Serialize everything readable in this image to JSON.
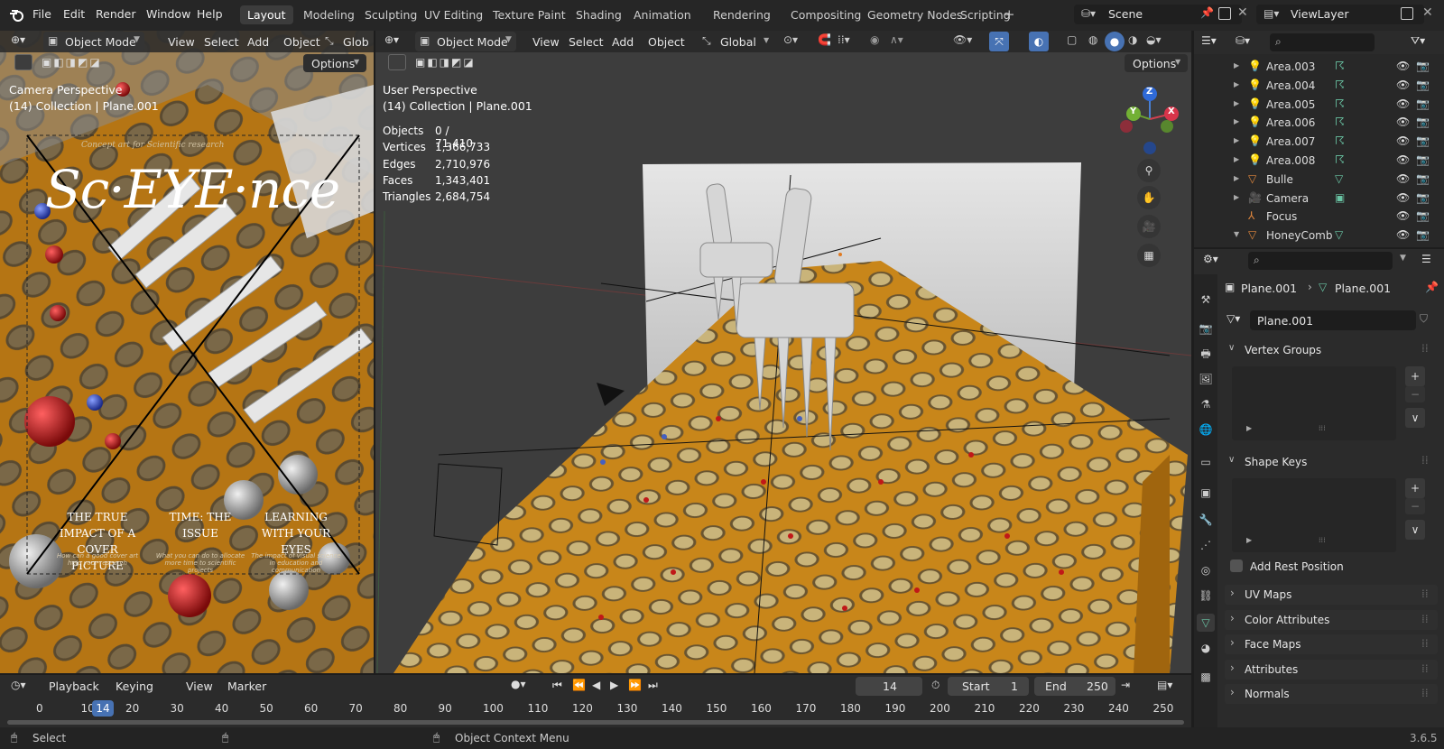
{
  "app": {
    "version": "3.6.5"
  },
  "menu": [
    "File",
    "Edit",
    "Render",
    "Window",
    "Help"
  ],
  "workspaces": [
    "Layout",
    "Modeling",
    "Sculpting",
    "UV Editing",
    "Texture Paint",
    "Shading",
    "Animation",
    "Rendering",
    "Compositing",
    "Geometry Nodes",
    "Scripting"
  ],
  "active_workspace": "Layout",
  "scene": {
    "name": "Scene",
    "view_layer": "ViewLayer"
  },
  "left_viewport": {
    "mode": "Object Mode",
    "menus": [
      "View",
      "Select",
      "Add",
      "Object"
    ],
    "transform": "Glob",
    "options": "Options",
    "perspective": "Camera Perspective",
    "collection": "(14) Collection | Plane.001",
    "poster": {
      "subtitle": "Concept art for Scientific research",
      "title": "Sc·EYE·nce",
      "cols": [
        {
          "head": "THE TRUE IMPACT OF A COVER PICTURE",
          "body": "How can a good cover art help your research"
        },
        {
          "head": "TIME: THE ISSUE",
          "body": "What you can do to allocate more time to scientific projects"
        },
        {
          "head": "LEARNING WITH YOUR EYES",
          "body": "The impact of visual science in education and communication"
        }
      ]
    }
  },
  "main_viewport": {
    "mode": "Object Mode",
    "menus": [
      "View",
      "Select",
      "Add",
      "Object"
    ],
    "transform": "Global",
    "options": "Options",
    "perspective": "User Perspective",
    "collection": "(14) Collection | Plane.001",
    "stats": [
      [
        "Objects",
        "0 / 71,410"
      ],
      [
        "Vertices",
        "1,366,733"
      ],
      [
        "Edges",
        "2,710,976"
      ],
      [
        "Faces",
        "1,343,401"
      ],
      [
        "Triangles",
        "2,684,754"
      ]
    ],
    "gizmo": {
      "z": "Z",
      "y": "Y",
      "x": "X"
    }
  },
  "outliner": {
    "items": [
      {
        "name": "Area.003",
        "type": "light",
        "expand": true
      },
      {
        "name": "Area.004",
        "type": "light",
        "expand": true
      },
      {
        "name": "Area.005",
        "type": "light",
        "expand": true
      },
      {
        "name": "Area.006",
        "type": "light",
        "expand": true
      },
      {
        "name": "Area.007",
        "type": "light",
        "expand": true
      },
      {
        "name": "Area.008",
        "type": "light",
        "expand": true
      },
      {
        "name": "Bulle",
        "type": "mesh",
        "expand": true
      },
      {
        "name": "Camera",
        "type": "camera",
        "expand": true
      },
      {
        "name": "Focus",
        "type": "empty",
        "expand": false
      },
      {
        "name": "HoneyComb",
        "type": "mesh",
        "expand": true
      }
    ]
  },
  "properties": {
    "breadcrumb": [
      "Plane.001",
      "Plane.001"
    ],
    "mesh_name": "Plane.001",
    "vertex_groups": "Vertex Groups",
    "shape_keys": "Shape Keys",
    "add_rest_position": "Add Rest Position",
    "collapsed": [
      "UV Maps",
      "Color Attributes",
      "Face Maps",
      "Attributes",
      "Normals"
    ]
  },
  "timeline": {
    "menus": [
      "Playback",
      "Keying",
      "View",
      "Marker"
    ],
    "current_frame": "14",
    "start_label": "Start",
    "start": "1",
    "end_label": "End",
    "end": "250",
    "ticks": [
      "0",
      "10",
      "20",
      "30",
      "40",
      "50",
      "60",
      "70",
      "80",
      "90",
      "100",
      "110",
      "120",
      "130",
      "140",
      "150",
      "160",
      "170",
      "180",
      "190",
      "200",
      "210",
      "220",
      "230",
      "240",
      "250"
    ]
  },
  "status": {
    "select": "Select",
    "context": "Object Context Menu"
  },
  "colors": {
    "accent": "#4772b3",
    "honey": "#c8861a",
    "orange_obj": "#e0873d",
    "green_data": "#69c3a3"
  }
}
